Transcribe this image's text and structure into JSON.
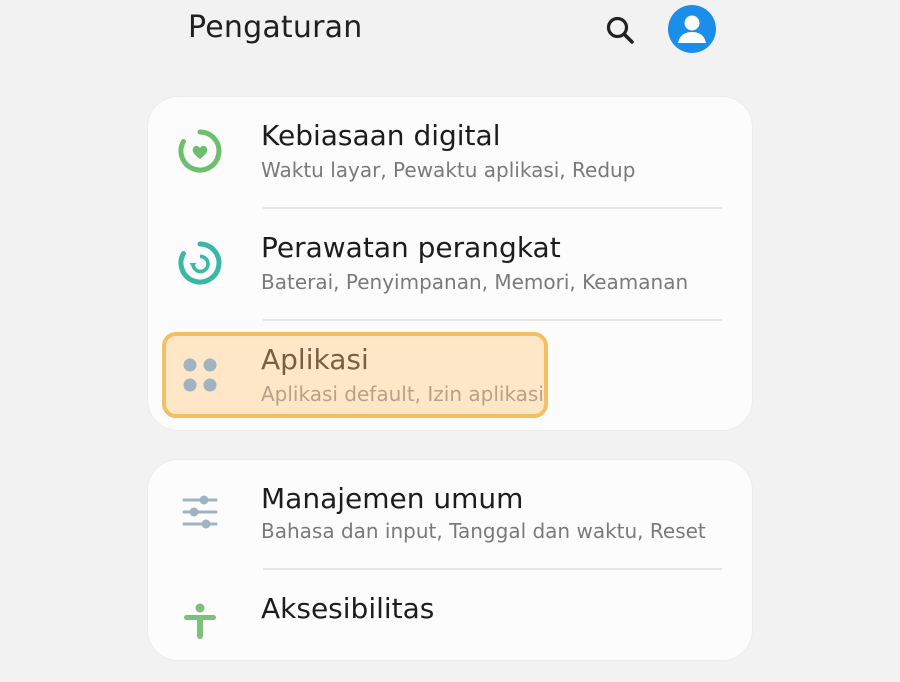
{
  "header": {
    "title": "Pengaturan",
    "search_icon": "search-icon",
    "avatar_icon": "account-icon"
  },
  "colors": {
    "background": "#f2f2f2",
    "card": "#fcfcfc",
    "avatar": "#1a8ee8",
    "highlight_fill": "#fde7c7",
    "highlight_border": "#f3bf62",
    "digital_wellbeing_green": "#6cbf6c",
    "device_care_teal": "#3bb8a4",
    "apps_grey": "#9fb3c3"
  },
  "cards": [
    {
      "items": [
        {
          "icon": "digital-wellbeing-icon",
          "title": "Kebiasaan digital",
          "subtitle": "Waktu layar, Pewaktu aplikasi, Redup"
        },
        {
          "icon": "device-care-icon",
          "title": "Perawatan perangkat",
          "subtitle": "Baterai, Penyimpanan, Memori, Keamanan"
        },
        {
          "icon": "apps-icon",
          "title": "Aplikasi",
          "subtitle": "Aplikasi default, Izin aplikasi",
          "highlighted": true
        }
      ]
    },
    {
      "items": [
        {
          "icon": "general-management-icon",
          "title": "Manajemen umum",
          "subtitle": "Bahasa dan input, Tanggal dan waktu, Reset"
        },
        {
          "icon": "accessibility-icon",
          "title": "Aksesibilitas",
          "subtitle": ""
        }
      ]
    }
  ]
}
